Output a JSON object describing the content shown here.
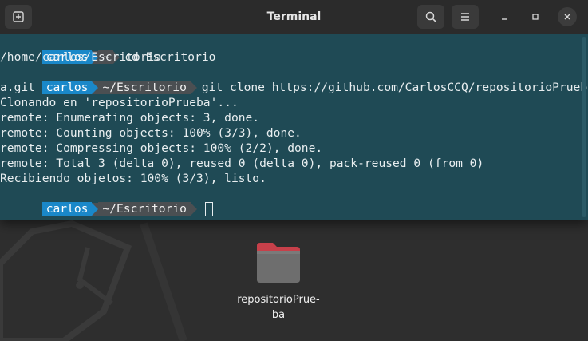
{
  "window": {
    "title": "Terminal",
    "buttons": {
      "new_tab_icon": "new-tab-icon",
      "search_icon": "search-icon",
      "menu_icon": "hamburger-menu-icon",
      "minimize_icon": "minimize-icon",
      "maximize_icon": "maximize-icon",
      "close_icon": "close-icon"
    }
  },
  "terminal": {
    "prompt1": {
      "user": "carlos",
      "dir": "~",
      "command": "cd Escritorio"
    },
    "out1": "/home/carlos/Escritorio",
    "prompt2": {
      "user": "carlos",
      "dir": "~/Escritorio",
      "command": "git clone https://github.com/CarlosCCQ/repositorioPrueb"
    },
    "wrap2": "a.git",
    "out_lines": [
      "Clonando en 'repositorioPrueba'...",
      "remote: Enumerating objects: 3, done.",
      "remote: Counting objects: 100% (3/3), done.",
      "remote: Compressing objects: 100% (2/2), done.",
      "remote: Total 3 (delta 0), reused 0 (delta 0), pack-reused 0 (from 0)",
      "Recibiendo objetos: 100% (3/3), listo."
    ],
    "prompt3": {
      "user": "carlos",
      "dir": "~/Escritorio"
    }
  },
  "desktop": {
    "folder_label_line1": "repositorioPrue-",
    "folder_label_line2": "ba"
  },
  "colors": {
    "terminal_bg": "#1f4a55",
    "prompt_user_bg": "#1a88c9",
    "prompt_dir_bg": "#4b4f52",
    "folder_accent": "#c7404a"
  }
}
